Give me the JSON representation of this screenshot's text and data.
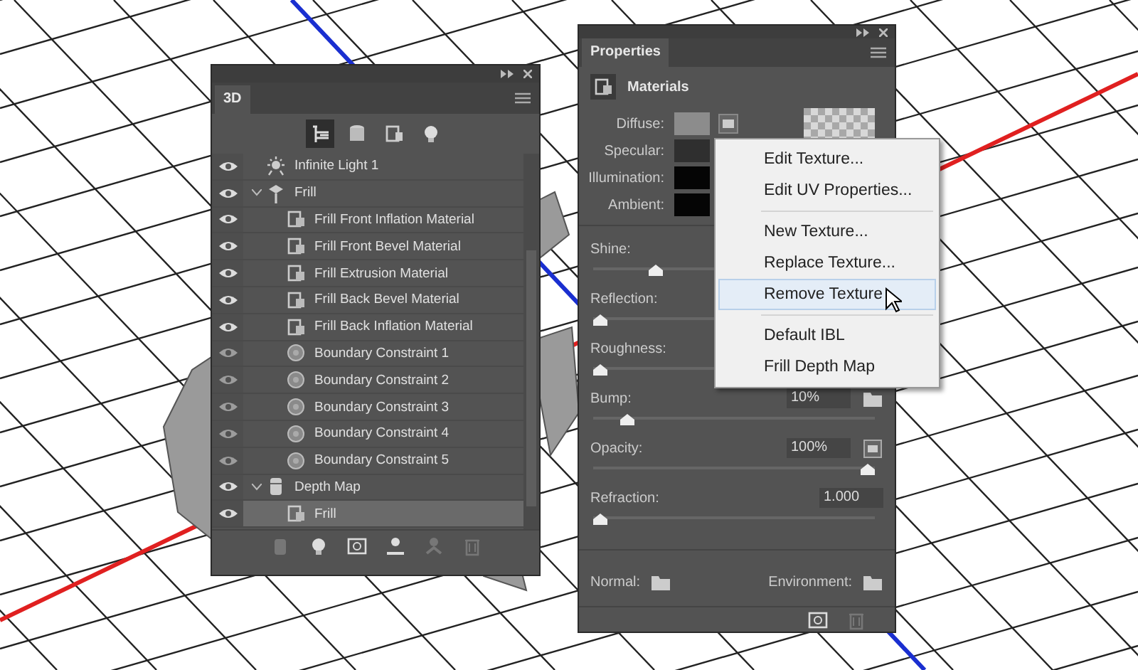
{
  "panel_3d": {
    "tab": "3D",
    "filters": [
      {
        "kind": "scene",
        "selected": true
      },
      {
        "kind": "meshes",
        "selected": false
      },
      {
        "kind": "materials",
        "selected": false
      },
      {
        "kind": "lights",
        "selected": false
      }
    ],
    "layers": [
      {
        "name": "Infinite Light 1",
        "kind": "light",
        "visible": true,
        "selected": false
      },
      {
        "name": "Frill",
        "kind": "mesh",
        "visible": true,
        "expanded": true,
        "selected": false,
        "children": [
          {
            "name": "Frill Front Inflation Material",
            "kind": "material",
            "visible": true,
            "selected": false
          },
          {
            "name": "Frill Front Bevel Material",
            "kind": "material",
            "visible": true,
            "selected": false
          },
          {
            "name": "Frill Extrusion Material",
            "kind": "material",
            "visible": true,
            "selected": false
          },
          {
            "name": "Frill Back Bevel Material",
            "kind": "material",
            "visible": true,
            "selected": false
          },
          {
            "name": "Frill Back Inflation Material",
            "kind": "material",
            "visible": true,
            "selected": false
          },
          {
            "name": "Boundary Constraint 1",
            "kind": "constraint",
            "visible": true,
            "selected": false
          },
          {
            "name": "Boundary Constraint 2",
            "kind": "constraint",
            "visible": true,
            "selected": false
          },
          {
            "name": "Boundary Constraint 3",
            "kind": "constraint",
            "visible": true,
            "selected": false
          },
          {
            "name": "Boundary Constraint 4",
            "kind": "constraint",
            "visible": true,
            "selected": false
          },
          {
            "name": "Boundary Constraint 5",
            "kind": "constraint",
            "visible": true,
            "selected": false
          }
        ]
      },
      {
        "name": "Depth Map",
        "kind": "depthmap",
        "visible": true,
        "expanded": true,
        "selected": false,
        "children": [
          {
            "name": "Frill",
            "kind": "material",
            "visible": true,
            "selected": true
          }
        ]
      }
    ]
  },
  "properties": {
    "tab": "Properties",
    "section": "Materials",
    "swatches": [
      {
        "label": "Diffuse:",
        "color": "#8c8c8c",
        "has_texture": true
      },
      {
        "label": "Specular:",
        "color": "#2f2f2f",
        "has_texture": false
      },
      {
        "label": "Illumination:",
        "color": "#050505",
        "has_texture": false
      },
      {
        "label": "Ambient:",
        "color": "#050505",
        "has_texture": false
      }
    ],
    "sliders": [
      {
        "label": "Shine:",
        "kind": "plain",
        "level": 0.21
      },
      {
        "label": "Reflection:",
        "kind": "plain",
        "level": 0
      },
      {
        "label": "Roughness:",
        "kind": "plain",
        "level": 0
      },
      {
        "label": "Bump:",
        "kind": "folder",
        "value": "10%",
        "level": 0.1
      },
      {
        "label": "Opacity:",
        "kind": "texture",
        "value": "100%",
        "level": 1
      },
      {
        "label": "Refraction:",
        "kind": "plain",
        "value": "1.000",
        "level": 0
      }
    ],
    "maps": [
      {
        "label": "Normal:"
      },
      {
        "label": "Environment:"
      }
    ]
  },
  "context_menu": {
    "groups": [
      [
        {
          "label": "Edit Texture...",
          "selected": false
        },
        {
          "label": "Edit UV Properties...",
          "selected": false
        }
      ],
      [
        {
          "label": "New Texture...",
          "selected": false
        },
        {
          "label": "Replace Texture...",
          "selected": false
        },
        {
          "label": "Remove Texture",
          "selected": true
        }
      ],
      [
        {
          "label": "Default IBL",
          "selected": false
        },
        {
          "label": "Frill Depth Map",
          "selected": false
        }
      ]
    ]
  }
}
